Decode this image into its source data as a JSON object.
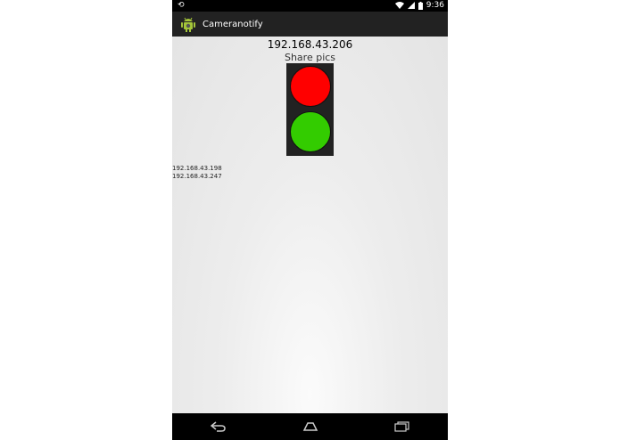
{
  "status_bar": {
    "left_icon": "sync-icon",
    "time": "9:36",
    "icons": [
      "wifi-icon",
      "signal-icon",
      "battery-icon"
    ]
  },
  "action_bar": {
    "app_icon": "android-icon",
    "title": "Cameranotify"
  },
  "main": {
    "ip_address": "192.168.43.206",
    "share_label": "Share pics",
    "traffic_light": {
      "colors": {
        "red": "#ff0000",
        "green": "#33cc00"
      }
    },
    "ip_list": [
      "192.168.43.198",
      "192.168.43.247"
    ]
  },
  "nav_bar": {
    "buttons": [
      "back-icon",
      "home-icon",
      "recents-icon"
    ]
  }
}
